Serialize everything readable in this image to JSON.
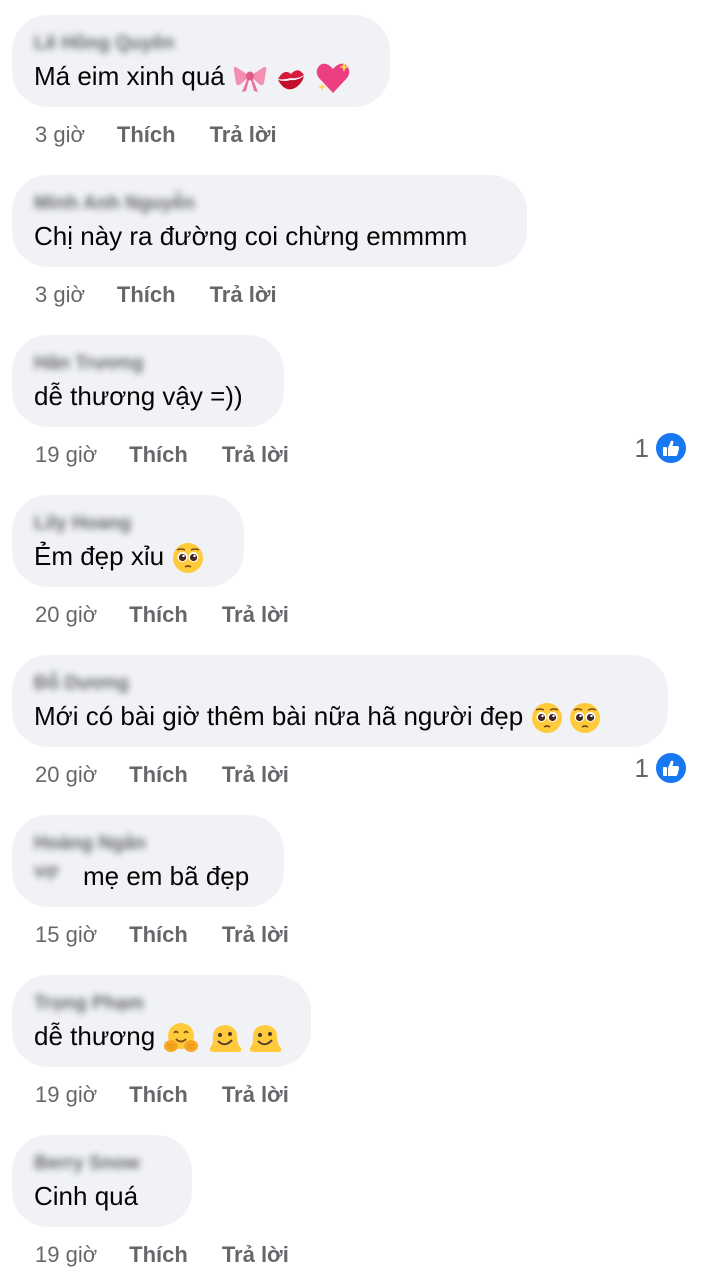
{
  "comments": [
    {
      "author": "Lê Hồng Quyên",
      "text": "Má eim xinh quá",
      "emojis": [
        "ribbon-icon",
        "kiss-mark-icon",
        "sparkling-heart-icon"
      ],
      "time": "3 giờ",
      "like_label": "Thích",
      "reply_label": "Trả lời",
      "likes": ""
    },
    {
      "author": "Minh Anh Nguyễn",
      "text": "Chị này ra đường coi chừng emmmm",
      "emojis": [],
      "time": "3 giờ",
      "like_label": "Thích",
      "reply_label": "Trả lời",
      "likes": ""
    },
    {
      "author": "Hân Trương",
      "text": "dễ thương vậy =))",
      "emojis": [],
      "time": "19 giờ",
      "like_label": "Thích",
      "reply_label": "Trả lời",
      "likes": "1"
    },
    {
      "author": "Lily Hoang",
      "text": "Ẻm đẹp xỉu",
      "emojis": [
        "pleading-face-icon"
      ],
      "time": "20 giờ",
      "like_label": "Thích",
      "reply_label": "Trả lời",
      "likes": ""
    },
    {
      "author": "Đỗ Dương",
      "text": "Mới có bài giờ thêm bài nữa hã người đẹp",
      "emojis": [
        "pleading-face-icon",
        "pleading-face-icon"
      ],
      "time": "20 giờ",
      "like_label": "Thích",
      "reply_label": "Trả lời",
      "likes": "1"
    },
    {
      "author": "Hoàng Ngân",
      "author_extra": "vợ",
      "text": "mẹ em bã đẹp",
      "emojis": [],
      "time": "15 giờ",
      "like_label": "Thích",
      "reply_label": "Trả lời",
      "likes": ""
    },
    {
      "author": "Trọng Phạm",
      "text": "dễ thương",
      "emojis": [
        "hugging-face-icon",
        "melting-face-icon",
        "melting-face-icon"
      ],
      "time": "19 giờ",
      "like_label": "Thích",
      "reply_label": "Trả lời",
      "likes": ""
    },
    {
      "author": "Berry Snow",
      "text": "Cinh quá",
      "emojis": [],
      "time": "19 giờ",
      "like_label": "Thích",
      "reply_label": "Trả lời",
      "likes": ""
    }
  ],
  "colors": {
    "bubble": "#f0f2f5",
    "meta": "#65676b",
    "like_badge": "#1877f2"
  }
}
